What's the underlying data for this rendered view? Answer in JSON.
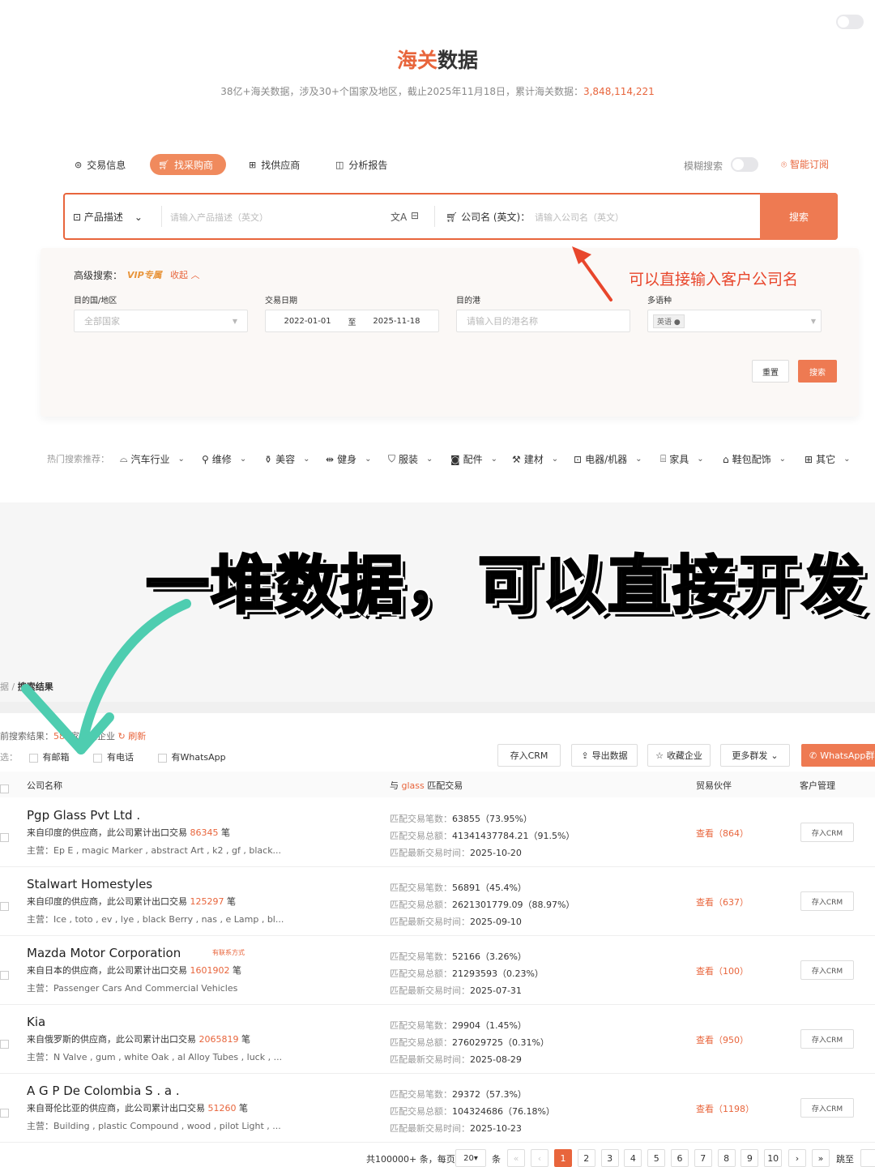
{
  "header": {
    "title_accent": "海关",
    "title_rest": "数据",
    "subtitle": "38亿+海关数据，涉及30+个国家及地区，截止2025年11月18日，累计海关数据：",
    "total": "3,848,114,221"
  },
  "tabs": [
    {
      "label": "交易信息"
    },
    {
      "label": "找采购商"
    },
    {
      "label": "找供应商"
    },
    {
      "label": "分析报告"
    }
  ],
  "fuzzy_label": "模糊搜索",
  "subscribe_label": "智能订阅",
  "search": {
    "field_select": "产品描述",
    "product_placeholder": "请输入产品描述（英文）",
    "company_label": "公司名 (英文)：",
    "company_placeholder": "请输入公司名（英文）",
    "button": "搜索"
  },
  "advanced": {
    "label": "高级搜索：",
    "vip": "VIP专属",
    "collapse": "收起",
    "annotation": "可以直接输入客户公司名",
    "country_label": "目的国/地区",
    "country_placeholder": "全部国家",
    "date_label": "交易日期",
    "date_from": "2022-01-01",
    "date_sep": "至",
    "date_to": "2025-11-18",
    "port_label": "目的港",
    "port_placeholder": "请输入目的港名称",
    "lang_label": "多语种",
    "lang_tag": "英语",
    "reset": "重置",
    "search": "搜索"
  },
  "hot": {
    "label": "热门搜索推荐：",
    "items": [
      "汽车行业",
      "维修",
      "美容",
      "健身",
      "服装",
      "配件",
      "建材",
      "电器/机器",
      "家具",
      "鞋包配饰",
      "其它"
    ]
  },
  "banner": {
    "text1": "一堆数据，",
    "text2": "可以直接开发"
  },
  "results": {
    "breadcrumb_prev": "据",
    "breadcrumb_sep": "/",
    "breadcrumb_cur": "搜索结果",
    "count_prefix": "前搜索结果：",
    "count": "580",
    "count_suffix": "家相关企业",
    "refresh": "刷新",
    "filter_prefix": "选：",
    "filters": [
      "有邮箱",
      "有电话",
      "有WhatsApp"
    ],
    "actions": [
      "存入CRM",
      "导出数据",
      "收藏企业",
      "更多群发"
    ],
    "whatsapp": "WhatsApp群",
    "columns": {
      "company": "公司名称",
      "with": "与",
      "keyword": "glass",
      "match": "匹配交易",
      "partner": "贸易伙伴",
      "crm": "客户管理"
    },
    "k_count": "匹配交易笔数：",
    "k_total": "匹配交易总额：",
    "k_time": "匹配最新交易时间：",
    "view": "查看",
    "crm_btn": "存入CRM",
    "unit": "笔",
    "main_prefix": "主营：",
    "rows": [
      {
        "name": "Pgp Glass Pvt Ltd .",
        "from": "来自印度的供应商，此公司累计出口交易",
        "exports": "86345",
        "main": "Ep E , magic Marker , abstract Art , k2 , gf , black...",
        "count": "63855（73.95%）",
        "total": "41341437784.21（91.5%）",
        "time": "2025-10-20",
        "partners": "（864）",
        "tag": ""
      },
      {
        "name": "Stalwart Homestyles",
        "from": "来自印度的供应商，此公司累计出口交易",
        "exports": "125297",
        "main": "Ice , toto , ev , lye , black Berry , nas , e Lamp , bl...",
        "count": "56891（45.4%）",
        "total": "2621301779.09（88.97%）",
        "time": "2025-09-10",
        "partners": "（637）",
        "tag": ""
      },
      {
        "name": "Mazda Motor Corporation",
        "from": "来自日本的供应商，此公司累计出口交易",
        "exports": "1601902",
        "main": "Passenger Cars And Commercial Vehicles",
        "count": "52166（3.26%）",
        "total": "21293593（0.23%）",
        "time": "2025-07-31",
        "partners": "（100）",
        "tag": "有联系方式"
      },
      {
        "name": "Kia",
        "from": "来自俄罗斯的供应商，此公司累计出口交易",
        "exports": "2065819",
        "main": "N Valve , gum , white Oak , al Alloy Tubes , luck , ...",
        "count": "29904（1.45%）",
        "total": "276029725（0.31%）",
        "time": "2025-08-29",
        "partners": "（950）",
        "tag": ""
      },
      {
        "name": "A G P De Colombia S . a .",
        "from": "来自哥伦比亚的供应商，此公司累计出口交易",
        "exports": "51260",
        "main": "Building , plastic Compound , wood , pilot Light , ...",
        "count": "29372（57.3%）",
        "total": "104324686（76.18%）",
        "time": "2025-10-23",
        "partners": "（1198）",
        "tag": ""
      }
    ]
  },
  "pagination": {
    "total": "共100000+ 条，每页",
    "per_page": "20",
    "unit": "条",
    "pages": [
      "1",
      "2",
      "3",
      "4",
      "5",
      "6",
      "7",
      "8",
      "9",
      "10"
    ],
    "jump": "跳至",
    "first": "«",
    "prev": "‹",
    "next": "›",
    "last": "»"
  },
  "colors": {
    "accent": "#e8653c",
    "button": "#ee7a52",
    "arrow": "#e8462c",
    "check": "#4ecdb0"
  }
}
